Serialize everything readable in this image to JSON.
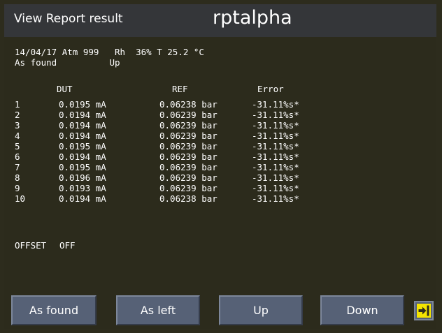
{
  "header": {
    "title": "View Report result",
    "brand": "rptalpha"
  },
  "report": {
    "conditions_line": "14/04/17 Atm 999   Rh  36% T 25.2 °C",
    "mode_line": "As found          Up",
    "column_headers": [
      "DUT",
      "REF",
      "Error"
    ],
    "rows": [
      {
        "index": "1",
        "dut": "0.0195 mA",
        "ref": "0.06238 bar",
        "error": "-31.11%s*"
      },
      {
        "index": "2",
        "dut": "0.0194 mA",
        "ref": "0.06239 bar",
        "error": "-31.11%s*"
      },
      {
        "index": "3",
        "dut": "0.0194 mA",
        "ref": "0.06239 bar",
        "error": "-31.11%s*"
      },
      {
        "index": "4",
        "dut": "0.0194 mA",
        "ref": "0.06239 bar",
        "error": "-31.11%s*"
      },
      {
        "index": "5",
        "dut": "0.0195 mA",
        "ref": "0.06239 bar",
        "error": "-31.11%s*"
      },
      {
        "index": "6",
        "dut": "0.0194 mA",
        "ref": "0.06239 bar",
        "error": "-31.11%s*"
      },
      {
        "index": "7",
        "dut": "0.0195 mA",
        "ref": "0.06239 bar",
        "error": "-31.11%s*"
      },
      {
        "index": "8",
        "dut": "0.0196 mA",
        "ref": "0.06239 bar",
        "error": "-31.11%s*"
      },
      {
        "index": "9",
        "dut": "0.0193 mA",
        "ref": "0.06239 bar",
        "error": "-31.11%s*"
      },
      {
        "index": "10",
        "dut": "0.0194 mA",
        "ref": "0.06238 bar",
        "error": "-31.11%s*"
      }
    ],
    "offset_label": "OFFSET",
    "offset_value": "OFF"
  },
  "toolbar": {
    "as_found_label": "As found",
    "as_left_label": "As left",
    "up_label": "Up",
    "down_label": "Down",
    "exit_icon": "exit-arrow-icon"
  },
  "colors": {
    "background": "#2d2c1d",
    "titlebar": "#343639",
    "button": "#566176",
    "exit_icon": "#f5e400"
  }
}
